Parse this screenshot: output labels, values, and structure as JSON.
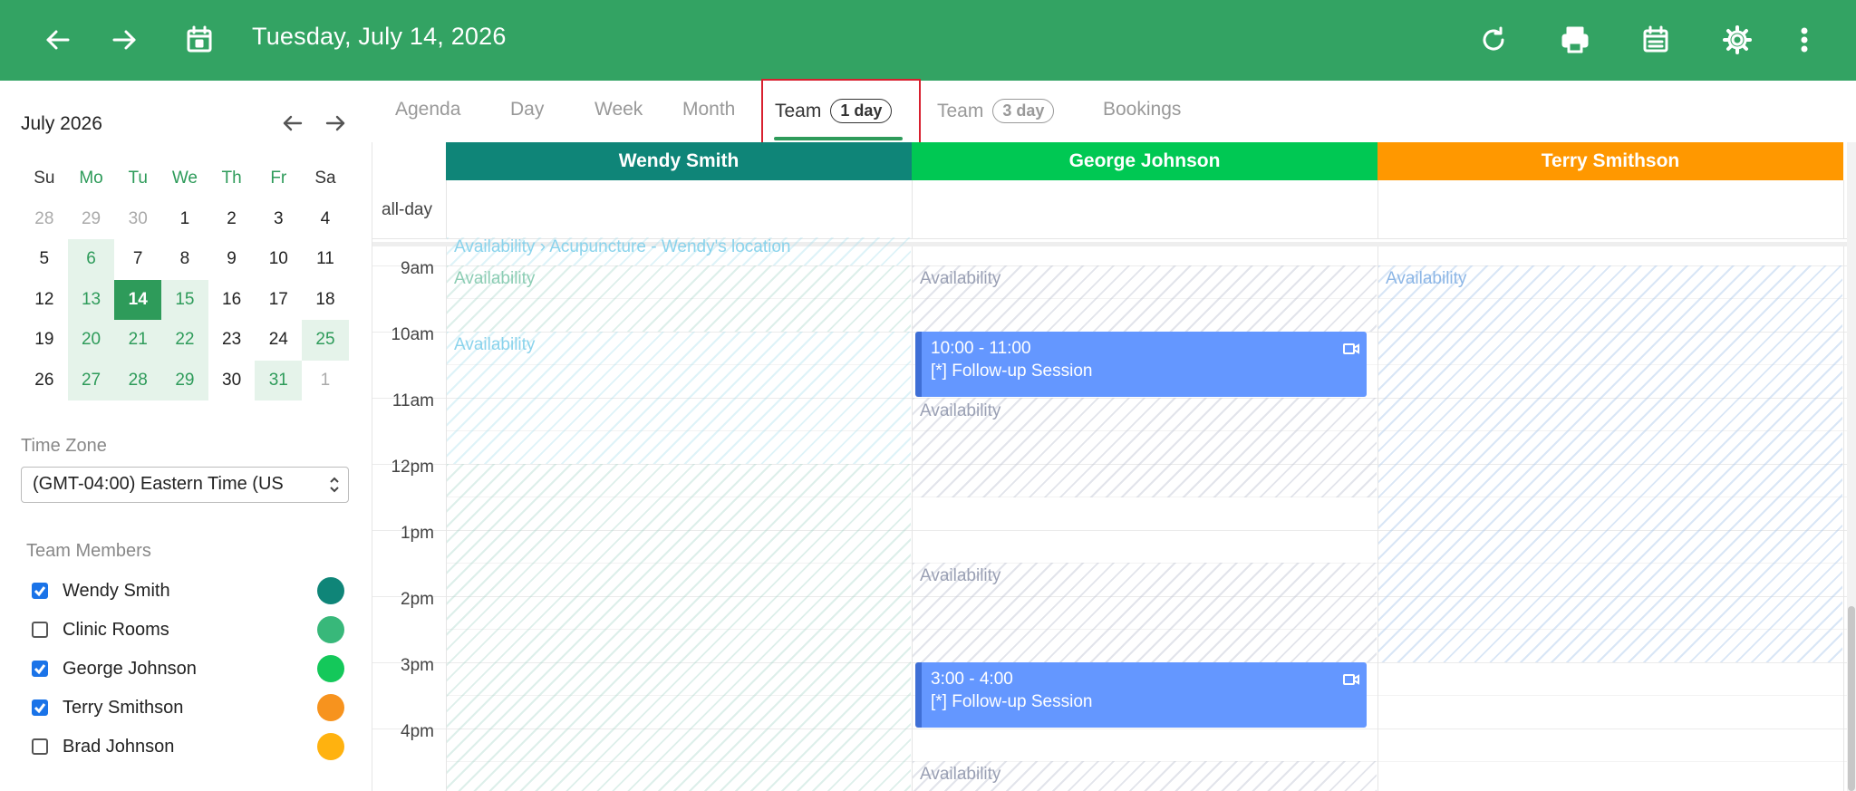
{
  "header": {
    "title": "Tuesday, July 14, 2026",
    "icons": [
      "arrow-left-icon",
      "arrow-right-icon",
      "calendar-icon",
      "refresh-icon",
      "print-icon",
      "calendar-icon",
      "gear-icon",
      "more-vert-icon"
    ],
    "bg_color": "#33a363"
  },
  "mini_calendar": {
    "title": "July 2026",
    "weekdays": [
      "Su",
      "Mo",
      "Tu",
      "We",
      "Th",
      "Fr",
      "Sa"
    ],
    "weeks": [
      [
        "28",
        "29",
        "30",
        "1",
        "2",
        "3",
        "4"
      ],
      [
        "5",
        "6",
        "7",
        "8",
        "9",
        "10",
        "11"
      ],
      [
        "12",
        "13",
        "14",
        "15",
        "16",
        "17",
        "18"
      ],
      [
        "19",
        "20",
        "21",
        "22",
        "23",
        "24",
        "25"
      ],
      [
        "26",
        "27",
        "28",
        "29",
        "30",
        "31",
        "1"
      ]
    ],
    "selected": "14"
  },
  "timezone": {
    "label": "Time Zone",
    "value": "(GMT-04:00) Eastern Time (US"
  },
  "team_members": {
    "label": "Team Members",
    "items": [
      {
        "name": "Wendy Smith",
        "checked": true,
        "color": "#0f8578"
      },
      {
        "name": "Clinic Rooms",
        "checked": false,
        "color": "#38b87a"
      },
      {
        "name": "George Johnson",
        "checked": true,
        "color": "#14c85a"
      },
      {
        "name": "Terry Smithson",
        "checked": true,
        "color": "#f7931e"
      },
      {
        "name": "Brad Johnson",
        "checked": false,
        "color": "#ffb20f"
      }
    ]
  },
  "tabs": [
    {
      "label": "Agenda"
    },
    {
      "label": "Day"
    },
    {
      "label": "Week"
    },
    {
      "label": "Month"
    },
    {
      "label": "Team",
      "pill": "1 day",
      "active": true
    },
    {
      "label": "Team",
      "pill": "3 day"
    },
    {
      "label": "Bookings"
    }
  ],
  "resources": [
    {
      "name": "Wendy Smith",
      "color": "#0f8578"
    },
    {
      "name": "George Johnson",
      "color": "#00c853"
    },
    {
      "name": "Terry Smithson",
      "color": "#ff9800"
    }
  ],
  "allday_label": "all-day",
  "times": [
    "9am",
    "10am",
    "11am",
    "12pm",
    "1pm",
    "2pm",
    "3pm",
    "4pm"
  ],
  "availability": {
    "wendy_top": "Availability › Acupuncture - Wendy's location",
    "wendy_9": "Availability",
    "wendy_10": "Availability",
    "george_9": "Availability",
    "george_11": "Availability",
    "george_1": "Availability",
    "george_4": "Availability",
    "terry_9": "Availability"
  },
  "events": [
    {
      "time": "10:00 - 11:00",
      "title": "[*] Follow-up Session",
      "icon": "video-icon"
    },
    {
      "time": "3:00 - 4:00",
      "title": "[*] Follow-up Session",
      "icon": "video-icon"
    }
  ]
}
